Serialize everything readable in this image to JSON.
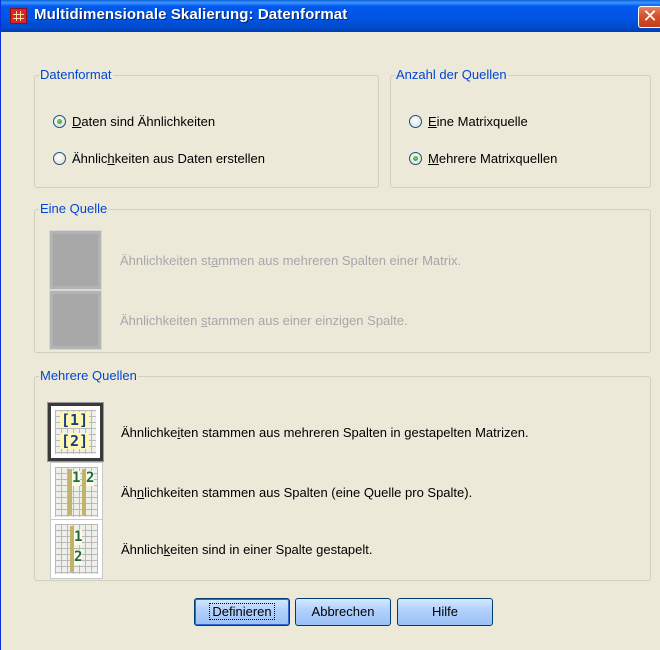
{
  "window": {
    "title": "Multidimensionale Skalierung: Datenformat",
    "close_glyph": "✕"
  },
  "datenformat": {
    "label": "Datenformat",
    "options": [
      {
        "pre": "",
        "ul": "D",
        "post": "aten sind Ähnlichkeiten",
        "checked": true
      },
      {
        "pre": "Ähnlic",
        "ul": "h",
        "post": "keiten aus Daten erstellen",
        "checked": false
      }
    ]
  },
  "anzahl": {
    "label": "Anzahl der Quellen",
    "options": [
      {
        "pre": "",
        "ul": "E",
        "post": "ine Matrixquelle",
        "checked": false
      },
      {
        "pre": "",
        "ul": "M",
        "post": "ehrere Matrixquellen",
        "checked": true
      }
    ]
  },
  "eine_quelle": {
    "label": "Eine Quelle",
    "options": [
      {
        "pre": "Ähnlichkeiten st",
        "ul": "a",
        "post": "mmen aus mehreren Spalten einer Matrix."
      },
      {
        "pre": "Ähnlichkeiten ",
        "ul": "s",
        "post": "tammen aus einer einzigen Spalte."
      }
    ]
  },
  "mehrere_quellen": {
    "label": "Mehrere Quellen",
    "options": [
      {
        "pre": "Ähnlichke",
        "ul": "i",
        "post": "ten stammen aus mehreren Spalten in gestapelten Matrizen.",
        "selected": true,
        "icon_labels": [
          "1",
          "2"
        ]
      },
      {
        "pre": "Äh",
        "ul": "n",
        "post": "lichkeiten stammen aus Spalten (eine Quelle pro Spalte).",
        "selected": false,
        "icon_labels": [
          "1",
          "2"
        ]
      },
      {
        "pre": "Ähnlich",
        "ul": "k",
        "post": "eiten sind in einer Spalte gestapelt.",
        "selected": false,
        "icon_labels": [
          "1",
          "2"
        ]
      }
    ]
  },
  "buttons": {
    "define": "Definieren",
    "cancel": "Abbrechen",
    "help": "Hilfe"
  }
}
